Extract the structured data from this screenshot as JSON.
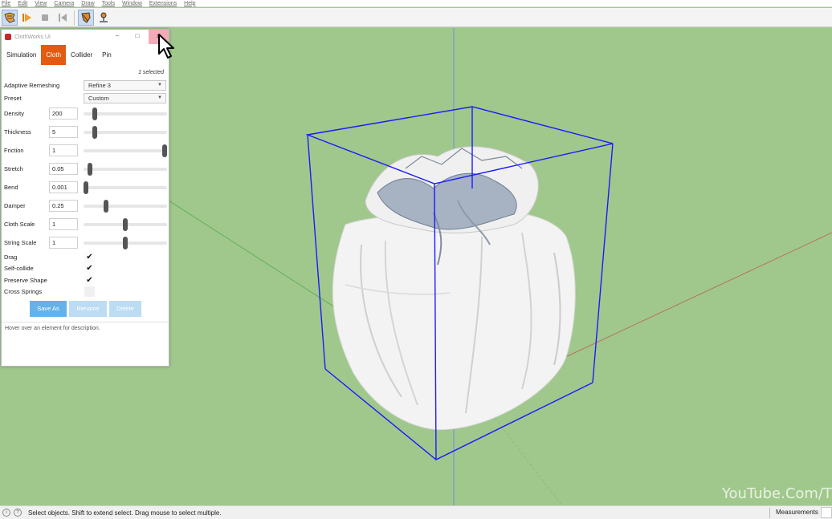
{
  "menu": [
    "File",
    "Edit",
    "View",
    "Camera",
    "Draw",
    "Tools",
    "Window",
    "Extensions",
    "Help"
  ],
  "toolbar": {
    "icons": [
      "clothworks-logo-icon",
      "play-icon",
      "stop-icon",
      "rewind-icon",
      "cloth-tool-icon",
      "pin-tool-icon"
    ]
  },
  "panel": {
    "title": "ClothWorks UI",
    "window_controls": {
      "minimize": "–",
      "maximize": "□",
      "close": "✕"
    },
    "tabs": [
      {
        "label": "Simulation",
        "active": false
      },
      {
        "label": "Cloth",
        "active": true
      },
      {
        "label": "Collider",
        "active": false
      },
      {
        "label": "Pin",
        "active": false
      }
    ],
    "selected_info": "1 selected",
    "adaptive_remeshing": {
      "label": "Adaptive Remeshing",
      "value": "Refine 3"
    },
    "preset": {
      "label": "Preset",
      "value": "Custom"
    },
    "sliders": [
      {
        "label": "Density",
        "value": "200",
        "level": 0.13
      },
      {
        "label": "Thickness",
        "value": "5",
        "level": 0.13
      },
      {
        "label": "Friction",
        "value": "1",
        "level": 0.97
      },
      {
        "label": "Stretch",
        "value": "0.05",
        "level": 0.08
      },
      {
        "label": "Bend",
        "value": "0.001",
        "level": 0.03
      },
      {
        "label": "Damper",
        "value": "0.25",
        "level": 0.27
      },
      {
        "label": "Cloth Scale",
        "value": "1",
        "level": 0.5
      },
      {
        "label": "String Scale",
        "value": "1",
        "level": 0.5
      }
    ],
    "checkboxes": [
      {
        "label": "Drag",
        "checked": true
      },
      {
        "label": "Self-collide",
        "checked": true
      },
      {
        "label": "Preserve Shape",
        "checked": true
      },
      {
        "label": "Cross Springs",
        "checked": false
      }
    ],
    "buttons": {
      "save_as": "Save As",
      "rename": "Rename",
      "delete": "Delete"
    },
    "hint": "Hover over an element for description."
  },
  "viewport": {
    "watermark": "YouTube.Com/T",
    "background_color": "#a0c88c",
    "bounding_box_color": "#1a1aff"
  },
  "status": {
    "message": "Select objects. Shift to extend select. Drag mouse to select multiple.",
    "measurements_label": "Measurements"
  }
}
